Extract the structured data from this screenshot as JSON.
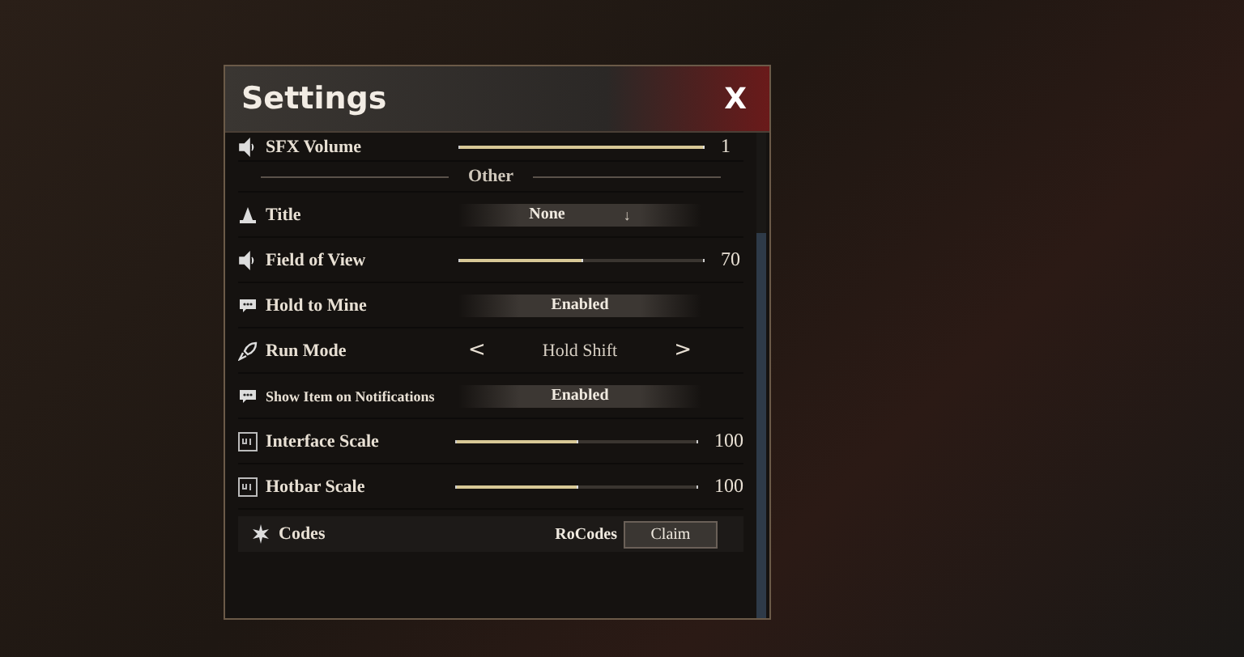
{
  "window": {
    "title": "Settings",
    "close": "X"
  },
  "rows": [
    {
      "kind": "slider",
      "label": "SFX Volume",
      "level": 1,
      "reading": "1"
    },
    {
      "kind": "section",
      "label": "Other"
    },
    {
      "kind": "dropdown",
      "label": "Title",
      "value": "None",
      "caret": "↓"
    },
    {
      "kind": "slider",
      "label": "Field of View",
      "level": 0.5,
      "reading": "70"
    },
    {
      "kind": "toggle",
      "label": "Hold to Mine",
      "value": "Enabled"
    },
    {
      "kind": "selector",
      "label": "Run Mode",
      "value": "Hold Shift",
      "prev": "<",
      "next": ">"
    },
    {
      "kind": "toggle",
      "label": "Show Item on Notifications",
      "value": "Enabled"
    },
    {
      "kind": "slider",
      "label": "Interface Scale",
      "level": 0.5,
      "reading": "100"
    },
    {
      "kind": "slider",
      "label": "Hotbar Scale",
      "level": 0.5,
      "reading": "100"
    },
    {
      "kind": "code",
      "label": "Codes",
      "value": "RoCodes",
      "button": "Claim"
    }
  ]
}
